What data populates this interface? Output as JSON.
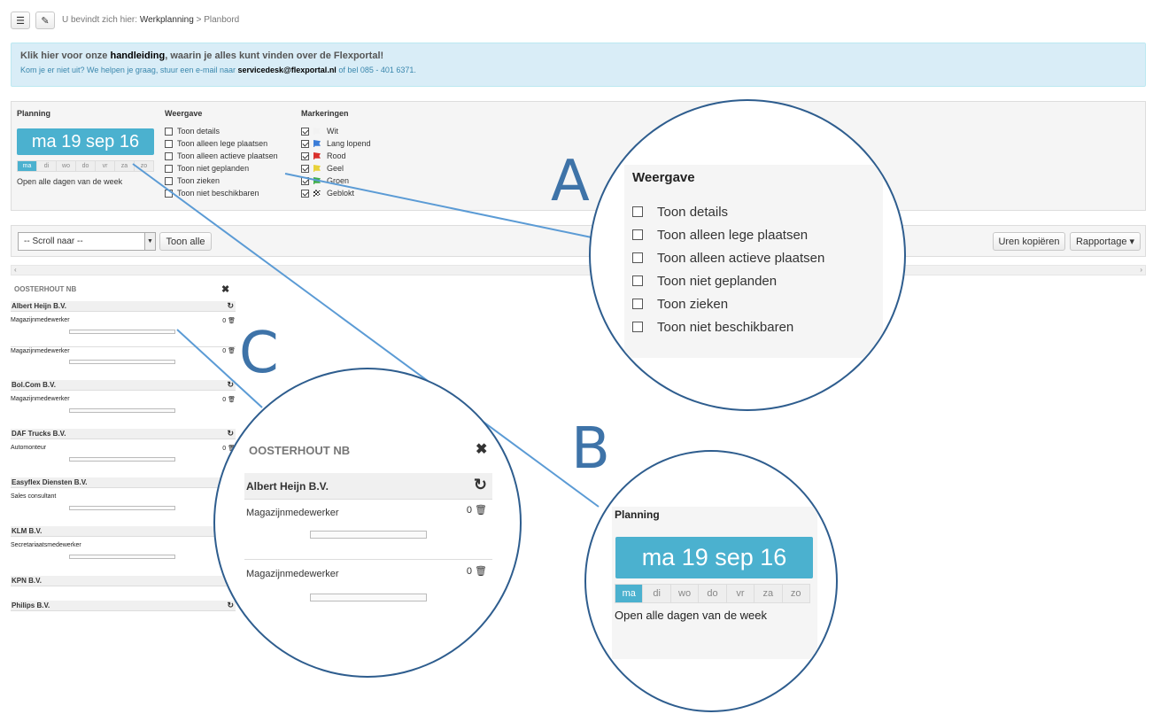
{
  "breadcrumb": {
    "prefix": "U bevindt zich hier:",
    "section": "Werkplanning",
    "sep": ">",
    "page": "Planbord"
  },
  "banner": {
    "line1_pre": "Klik hier voor onze ",
    "line1_bold": "handleiding",
    "line1_post": ", waarin je alles kunt vinden over de Flexportal!",
    "line2_pre": "Kom je er niet uit? We helpen je graag, stuur een e-mail naar ",
    "line2_email": "servicedesk@flexportal.nl",
    "line2_post": " of bel 085 - 401 6371."
  },
  "planning": {
    "title": "Planning",
    "date": "ma 19 sep 16",
    "days": [
      "ma",
      "di",
      "wo",
      "do",
      "vr",
      "za",
      "zo"
    ],
    "open_all": "Open alle dagen van de week"
  },
  "weergave": {
    "title": "Weergave",
    "options": [
      "Toon details",
      "Toon alleen lege plaatsen",
      "Toon alleen actieve plaatsen",
      "Toon niet geplanden",
      "Toon zieken",
      "Toon niet beschikbaren"
    ]
  },
  "markeringen": {
    "title": "Markeringen",
    "options": [
      {
        "label": "Wit",
        "color": "#f2f2f2"
      },
      {
        "label": "Lang lopend",
        "color": "#3b7dd8"
      },
      {
        "label": "Rood",
        "color": "#d9302c"
      },
      {
        "label": "Geel",
        "color": "#e8d23a"
      },
      {
        "label": "Groen",
        "color": "#3fae49"
      },
      {
        "label": "Geblokt",
        "color": "#333333"
      }
    ]
  },
  "toolbar": {
    "scroll_placeholder": "-- Scroll naar --",
    "toon_alle": "Toon alle",
    "uren_kopieren": "Uren kopiëren",
    "rapportage": "Rapportage ▾"
  },
  "location": {
    "name": "OOSTERHOUT NB"
  },
  "companies": [
    "Albert Heijn B.V.",
    "Bol.Com B.V.",
    "DAF Trucks B.V.",
    "Easyflex Diensten B.V.",
    "KLM B.V.",
    "KPN B.V.",
    "Philips B.V."
  ],
  "jobs": [
    "Magazijnmedewerker",
    "Magazijnmedewerker",
    "Magazijnmedewerker",
    "Automonteur",
    "Sales consultant",
    "Secretariaatsmedewerker"
  ],
  "job_count": "0",
  "callouts": {
    "a": "A",
    "b": "B",
    "c": "C"
  },
  "icons": {
    "menu": "menu-icon",
    "pin": "pin-icon",
    "close": "close-icon",
    "refresh": "refresh-icon",
    "trash": "trash-icon"
  }
}
